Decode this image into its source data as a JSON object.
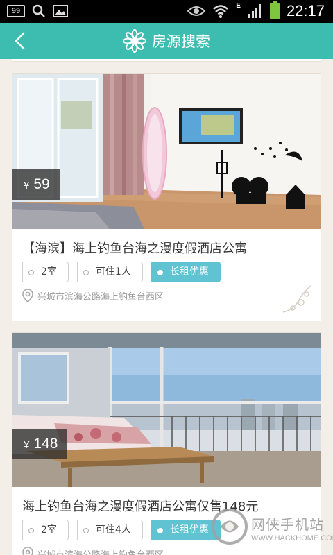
{
  "status_bar": {
    "badge": "99",
    "network": "E",
    "time": "22:17"
  },
  "header": {
    "title": "房源搜索"
  },
  "listings": [
    {
      "price_symbol": "¥",
      "price": "59",
      "name": "【海滨】海上钓鱼台海之漫度假酒店公寓",
      "tags": [
        "2室",
        "可住1人",
        "长租优惠"
      ],
      "address": "兴城市滨海公路海上钓鱼台西区"
    },
    {
      "price_symbol": "¥",
      "price": "148",
      "name": "海上钓鱼台海之漫度假酒店公寓仅售148元",
      "tags": [
        "2室",
        "可住4人",
        "长租优惠"
      ],
      "address": "兴城市滨海公路海上钓鱼台西区"
    }
  ],
  "watermark": {
    "name": "网侠手机站",
    "url": "WWW.HACKHOME.COM"
  },
  "colors": {
    "header_bg": "#3dbdb0",
    "tag_highlight": "#5fc3d2",
    "page_bg": "#f3efe8"
  }
}
